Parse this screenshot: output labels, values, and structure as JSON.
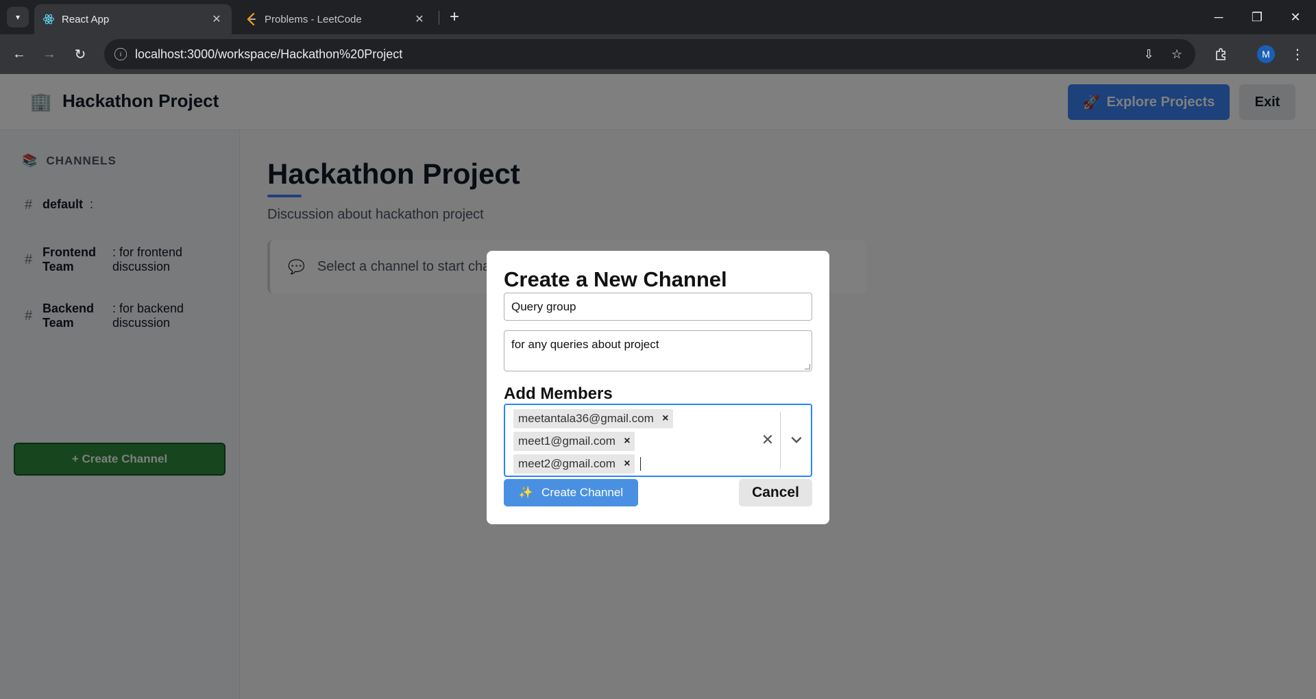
{
  "browser": {
    "tabs": [
      {
        "title": "React App",
        "icon": "react-icon",
        "active": true
      },
      {
        "title": "Problems - LeetCode",
        "icon": "leetcode-icon",
        "active": false
      }
    ],
    "url": "localhost:3000/workspace/Hackathon%20Project",
    "profile_initial": "M"
  },
  "header": {
    "title": "Hackathon Project",
    "explore_label": "Explore Projects",
    "exit_label": "Exit"
  },
  "sidebar": {
    "heading": "CHANNELS",
    "channels": [
      {
        "name": "default",
        "desc": ":"
      },
      {
        "name": "Frontend Team",
        "desc": ": for frontend discussion"
      },
      {
        "name": "Backend Team",
        "desc": ": for backend discussion"
      }
    ],
    "create_label": "+ Create Channel"
  },
  "main": {
    "title": "Hackathon Project",
    "description": "Discussion about hackathon project",
    "placeholder": "Select a channel to start chatting"
  },
  "modal": {
    "title": "Create a New Channel",
    "name_value": "Query group",
    "desc_value": "for any queries about project",
    "members_label": "Add Members",
    "members": [
      "meetantala36@gmail.com",
      "meet1@gmail.com",
      "meet2@gmail.com"
    ],
    "create_label": "Create Channel",
    "cancel_label": "Cancel"
  },
  "colors": {
    "primary": "#3b82f6",
    "create_green": "#2e8b3a",
    "focus_border": "#2684ff"
  }
}
